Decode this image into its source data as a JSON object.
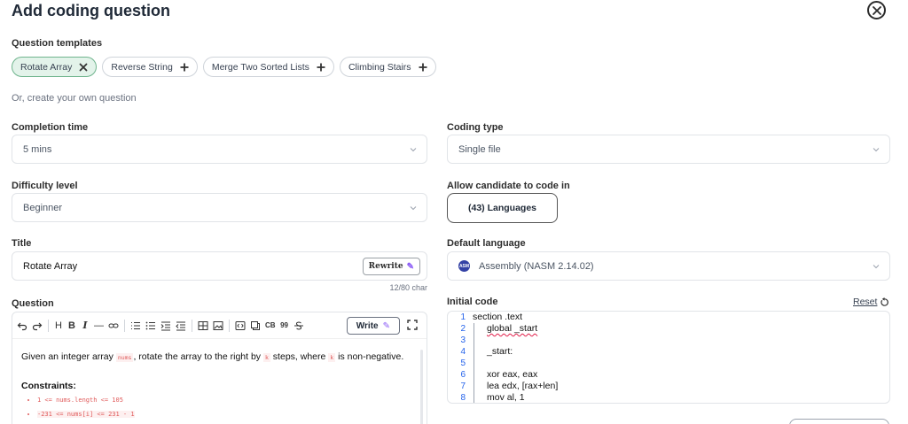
{
  "header": {
    "title": "Add coding question"
  },
  "templates": {
    "label": "Question templates",
    "chips": [
      {
        "label": "Rotate Array",
        "active": true,
        "icon": "close-icon"
      },
      {
        "label": "Reverse String",
        "active": false,
        "icon": "plus-icon"
      },
      {
        "label": "Merge Two Sorted Lists",
        "active": false,
        "icon": "plus-icon"
      },
      {
        "label": "Climbing Stairs",
        "active": false,
        "icon": "plus-icon"
      }
    ],
    "custom_hint": "Or, create your own question"
  },
  "completion_time": {
    "label": "Completion time",
    "value": "5 mins"
  },
  "coding_type": {
    "label": "Coding type",
    "value": "Single file"
  },
  "difficulty": {
    "label": "Difficulty level",
    "value": "Beginner"
  },
  "allow_languages": {
    "label": "Allow candidate to code in",
    "button": "(43) Languages"
  },
  "title_field": {
    "label": "Title",
    "value": "Rotate Array",
    "rewrite": "Rewrite",
    "counter": "12/80 char"
  },
  "default_language": {
    "label": "Default language",
    "value": "Assembly (NASM 2.14.02)",
    "icon_text": "ASM"
  },
  "question": {
    "label": "Question",
    "write_button": "Write",
    "toolbar_text": {
      "cb": "CB",
      "quote": "99"
    },
    "body": {
      "part1": "Given an integer array ",
      "code1": "nums",
      "part2": ", rotate the array to the right by ",
      "code2": "k",
      "part3": " steps, where ",
      "code3": "k",
      "part4": " is non-negative."
    },
    "constraints_title": "Constraints:",
    "constraints": [
      "1 <= nums.length <= 105",
      "-231 <= nums[i] <= 231 - 1"
    ]
  },
  "initial_code": {
    "label": "Initial code",
    "reset": "Reset",
    "lines": [
      {
        "n": "1",
        "text": "section .text"
      },
      {
        "n": "2",
        "text": "global _start"
      },
      {
        "n": "3",
        "text": ""
      },
      {
        "n": "4",
        "text": "_start:"
      },
      {
        "n": "5",
        "text": ""
      },
      {
        "n": "6",
        "text": "xor eax, eax"
      },
      {
        "n": "7",
        "text": "lea edx, [rax+len]"
      },
      {
        "n": "8",
        "text": "mov al, 1"
      }
    ]
  }
}
